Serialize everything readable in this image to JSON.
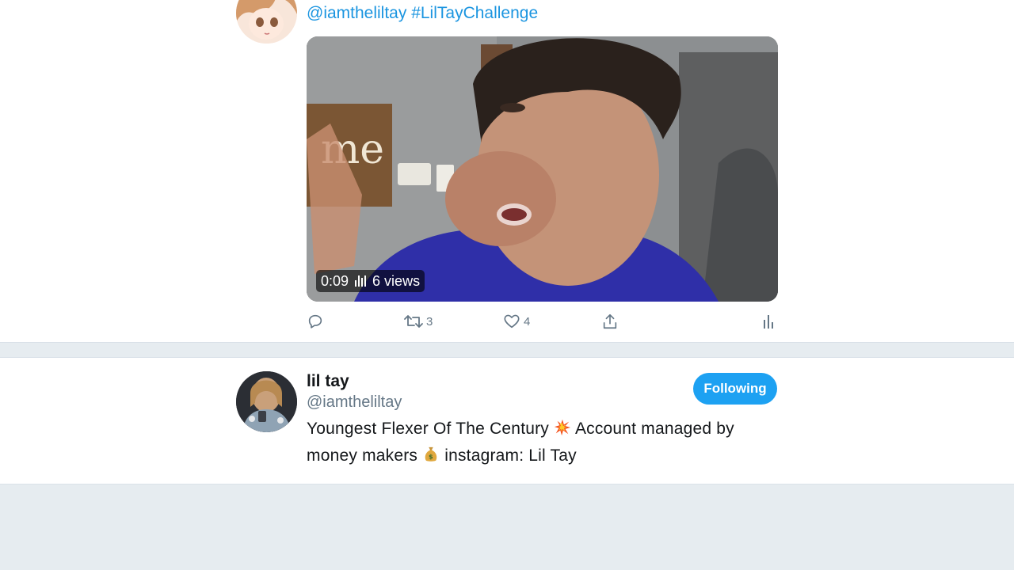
{
  "tweet": {
    "mention": "@iamtheliltay",
    "hashtag": "#LilTayChallenge",
    "video": {
      "duration": "0:09",
      "views": "6 views"
    },
    "actions": {
      "reply_count": "",
      "retweet_count": "3",
      "like_count": "4"
    }
  },
  "profile": {
    "name": "lil tay",
    "handle": "@iamtheliltay",
    "follow_label": "Following",
    "bio_part1": "Youngest Flexer Of The Century",
    "bio_part2": "Account managed by",
    "bio_part3": "money makers",
    "bio_part4": "instagram: Lil Tay"
  },
  "colors": {
    "accent": "#1da1f2",
    "link": "#1b95e0",
    "muted": "#657786",
    "background": "#e6ecf0"
  },
  "icons": [
    "reply-icon",
    "retweet-icon",
    "like-icon",
    "share-icon",
    "analytics-icon",
    "collision-emoji",
    "money-bag-emoji"
  ]
}
